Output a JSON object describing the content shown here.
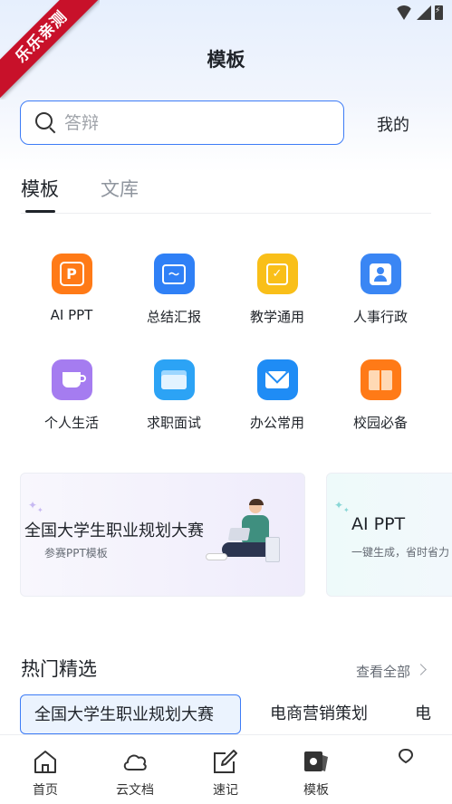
{
  "watermark": "乐乐亲测",
  "title": "模板",
  "search": {
    "placeholder": "答辩"
  },
  "mine": "我的",
  "tabs": [
    {
      "label": "模板"
    },
    {
      "label": "文库"
    }
  ],
  "categories": [
    {
      "label": "AI PPT",
      "icon": "ai-ppt-icon",
      "color": "#ff7a17"
    },
    {
      "label": "总结汇报",
      "icon": "summary-chart-icon",
      "color": "#2f80f6"
    },
    {
      "label": "教学通用",
      "icon": "teaching-check-icon",
      "color": "#f9bf19"
    },
    {
      "label": "人事行政",
      "icon": "person-icon",
      "color": "#3a86f4"
    },
    {
      "label": "个人生活",
      "icon": "coffee-cup-icon",
      "color": "#a57cf0"
    },
    {
      "label": "求职面试",
      "icon": "folder-icon",
      "color": "#2ca3f5"
    },
    {
      "label": "办公常用",
      "icon": "mail-icon",
      "color": "#1f8cf5"
    },
    {
      "label": "校园必备",
      "icon": "book-icon",
      "color": "#ff7a17"
    }
  ],
  "banners": [
    {
      "title": "全国大学生职业规划大赛",
      "subtitle": "参赛PPT模板"
    },
    {
      "title": "AI PPT",
      "subtitle": "一键生成，省时省力"
    }
  ],
  "hot": {
    "title": "热门精选",
    "see_all": "查看全部",
    "chips": [
      "全国大学生职业规划大赛",
      "电商营销策划",
      "电"
    ]
  },
  "nav": [
    {
      "label": "首页",
      "icon": "home-icon"
    },
    {
      "label": "云文档",
      "icon": "cloud-icon"
    },
    {
      "label": "速记",
      "icon": "edit-note-icon"
    },
    {
      "label": "模板",
      "icon": "template-icon"
    },
    {
      "label": "",
      "icon": "location-pin-icon"
    }
  ],
  "colors": {
    "accent": "#3d7cf6",
    "watermark": "#c8112a"
  }
}
